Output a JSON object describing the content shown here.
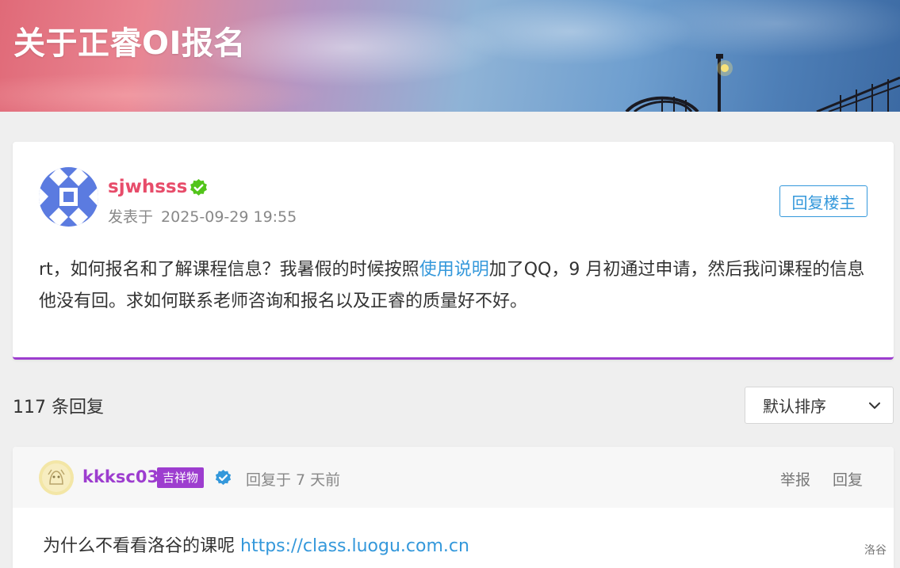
{
  "header": {
    "title": "关于正睿OI报名"
  },
  "post": {
    "author": "sjwhsss",
    "posted_label": "发表于",
    "timestamp": "2025-09-29 19:55",
    "reply_op_label": "回复楼主",
    "body_part1": "rt，如何报名和了解课程信息？我暑假的时候按照",
    "body_link": "使用说明",
    "body_part2": "加了QQ，9 月初通过申请，然后我问课程的信息他没有回。求如何联系老师咨询和报名以及正睿的质量好不好。",
    "author_color": "#e74c6a",
    "avatar_icon": "identicon-avatar",
    "verified_icon": "verified-check-icon"
  },
  "replies_bar": {
    "count_label": "117 条回复",
    "sort_selected": "默认排序"
  },
  "reply": {
    "author": "kkksc03",
    "badge": "吉祥物",
    "time": "回复于 7 天前",
    "report_label": "举报",
    "reply_label": "回复",
    "body_text": "为什么不看看洛谷的课呢",
    "body_link": "https://class.luogu.com.cn",
    "author_color": "#9d3dcf",
    "verified_icon": "verified-check-icon"
  },
  "watermark": "洛谷",
  "colors": {
    "accent_purple": "#9d3dcf",
    "link_blue": "#3498db",
    "verified_green": "#52c41a",
    "verified_blue": "#3498db"
  }
}
